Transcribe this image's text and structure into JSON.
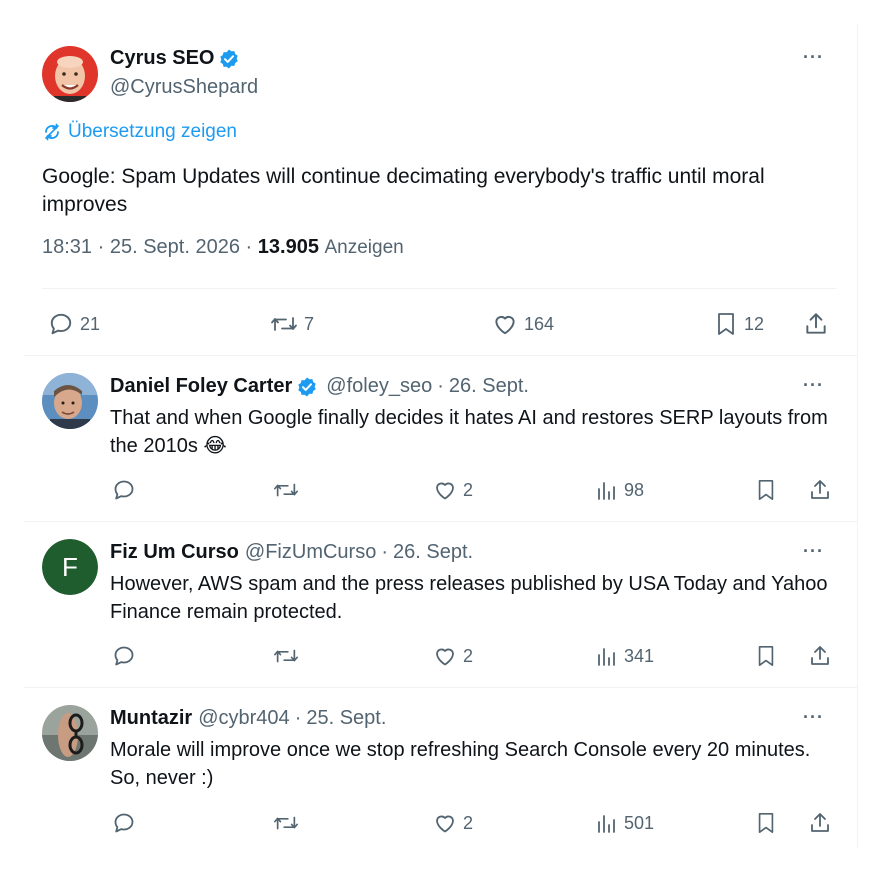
{
  "main_tweet": {
    "display_name": "Cyrus SEO",
    "handle": "@CyrusShepard",
    "translate_label": "Übersetzung zeigen",
    "text": "Google: Spam Updates will continue decimating everybody's traffic until moral improves",
    "time": "18:31",
    "date": "25. Sept. 2026",
    "separator": "·",
    "views": "13.905",
    "views_label": "Anzeigen",
    "replies": "21",
    "retweets": "7",
    "likes": "164",
    "bookmarks": "12",
    "more_label": "···"
  },
  "replies": [
    {
      "display_name": "Daniel Foley Carter",
      "verified": true,
      "handle": "@foley_seo",
      "date": "26. Sept.",
      "text": "That and when Google finally decides it hates AI and restores SERP layouts from the 2010s 😂",
      "likes": "2",
      "views": "98",
      "more_label": "···"
    },
    {
      "display_name": "Fiz Um Curso",
      "verified": false,
      "handle": "@FizUmCurso",
      "date": "26. Sept.",
      "avatar_letter": "F",
      "text": "However, AWS spam and the press releases published by USA Today and Yahoo Finance remain protected.",
      "likes": "2",
      "views": "341",
      "more_label": "···"
    },
    {
      "display_name": "Muntazir",
      "verified": false,
      "handle": "@cybr404",
      "date": "25. Sept.",
      "text": "Morale will improve once we stop refreshing Search Console every 20 minutes. So, never :)",
      "likes": "2",
      "views": "501",
      "more_label": "···"
    }
  ],
  "colors": {
    "accent": "#1d9bf0",
    "secondary_text": "#536471",
    "primary_text": "#0f1419",
    "divider": "#eff3f4",
    "fiz_avatar": "#1f5d2e"
  },
  "icons": [
    "verified-badge-icon",
    "more-icon",
    "translate-icon",
    "reply-icon",
    "retweet-icon",
    "like-icon",
    "views-icon",
    "bookmark-icon",
    "share-icon"
  ]
}
